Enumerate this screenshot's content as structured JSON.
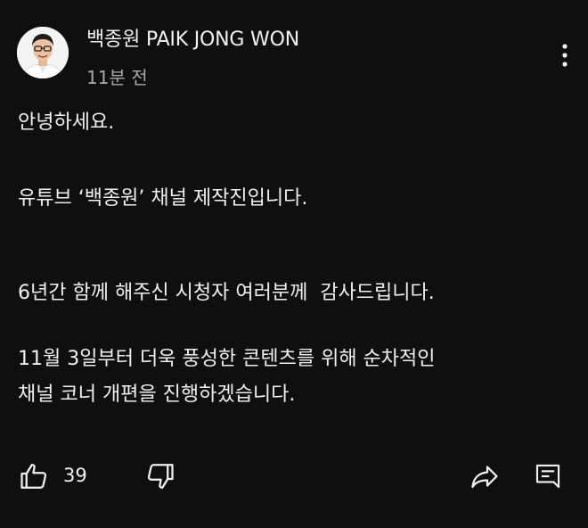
{
  "post": {
    "channel_name": "백종원 PAIK JONG WON",
    "timestamp": "11분 전",
    "avatar_icon": "channel-avatar",
    "more_icon": "more-vertical-icon",
    "lines": [
      "안녕하세요.",
      "유튜브 ‘백종원’ 채널 제작진입니다.",
      "6년간 함께 해주신 시청자 여러분께  감사드립니다.",
      "11월 3일부터 더욱 풍성한 콘텐츠를 위해 순차적인",
      "채널 코너 개편을 진행하겠습니다."
    ]
  },
  "actions": {
    "like_count": "39",
    "like_icon": "thumbs-up-icon",
    "dislike_icon": "thumbs-down-icon",
    "share_icon": "share-icon",
    "comment_icon": "comment-icon"
  },
  "colors": {
    "background": "#0f0f0f",
    "text": "#f1f1f1",
    "secondary_text": "#aaaaaa"
  }
}
